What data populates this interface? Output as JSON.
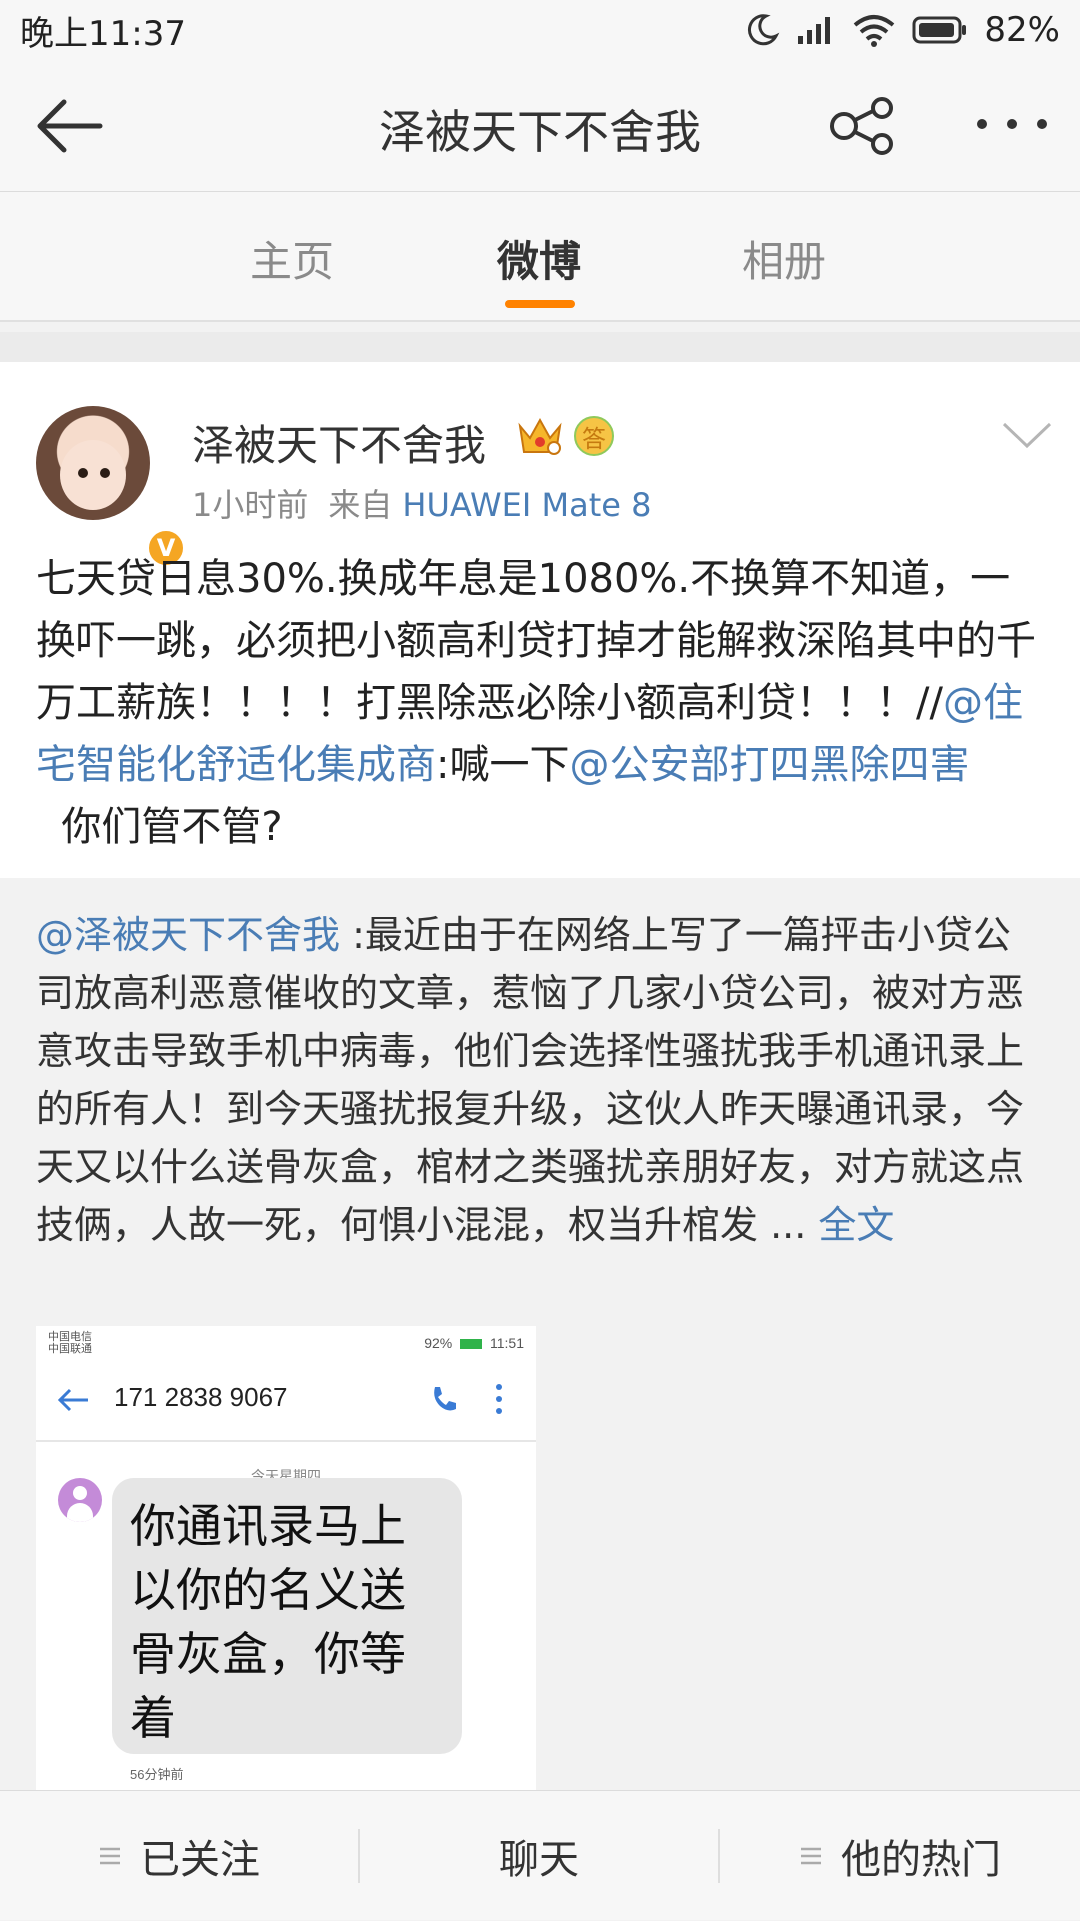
{
  "status_bar": {
    "time": "晚上11:37",
    "battery": "82%"
  },
  "nav": {
    "title": "泽被天下不舍我"
  },
  "tabs": [
    {
      "label": "主页",
      "active": false
    },
    {
      "label": "微博",
      "active": true
    },
    {
      "label": "相册",
      "active": false
    }
  ],
  "post": {
    "username": "泽被天下不舍我",
    "verified_badge": "V",
    "answer_badge": "答",
    "time": "1小时前",
    "source_prefix": "来自",
    "device": "HUAWEI Mate 8",
    "text_part1": "七天贷日息30%.换成年息是1080%.不换算不知道，一换吓一跳，必须把小额高利贷打掉才能解救深陷其中的千万工薪族！！！！打黑除恶必除小额高利贷！！！//",
    "mention1": "@住宅智能化舒适化集成商",
    "text_part2": ":喊一下",
    "mention2": "@公安部打四黑除四害",
    "text_part3": "  你们管不管?"
  },
  "repost": {
    "mention": "@泽被天下不舍我",
    "text": " :最近由于在网络上写了一篇抨击小贷公司放高利恶意催收的文章，惹恼了几家小贷公司，被对方恶意攻击导致手机中病毒，他们会选择性骚扰我手机通讯录上的所有人！到今天骚扰报复升级，这伙人昨天曝通讯录，今天又以什么送骨灰盒，棺材之类骚扰亲朋好友，对方就这点技俩，人故一死，何惧小混混，权当升棺发 ... ",
    "more_link": "全文",
    "screenshot": {
      "carrier_1": "中国电信",
      "carrier_2": "中国联通",
      "status_battery": "92%",
      "status_time": "11:51",
      "phone_number": "171 2838 9067",
      "day_label": "今天星期四",
      "message": "你通讯录马上以你的名义送骨灰盒，你等着",
      "message_time": "56分钟前"
    }
  },
  "bottom_bar": {
    "following": "已关注",
    "chat": "聊天",
    "hot": "他的热门"
  },
  "colors": {
    "link": "#4a7db5",
    "accent": "#ff8200",
    "verified": "#f5a623"
  }
}
